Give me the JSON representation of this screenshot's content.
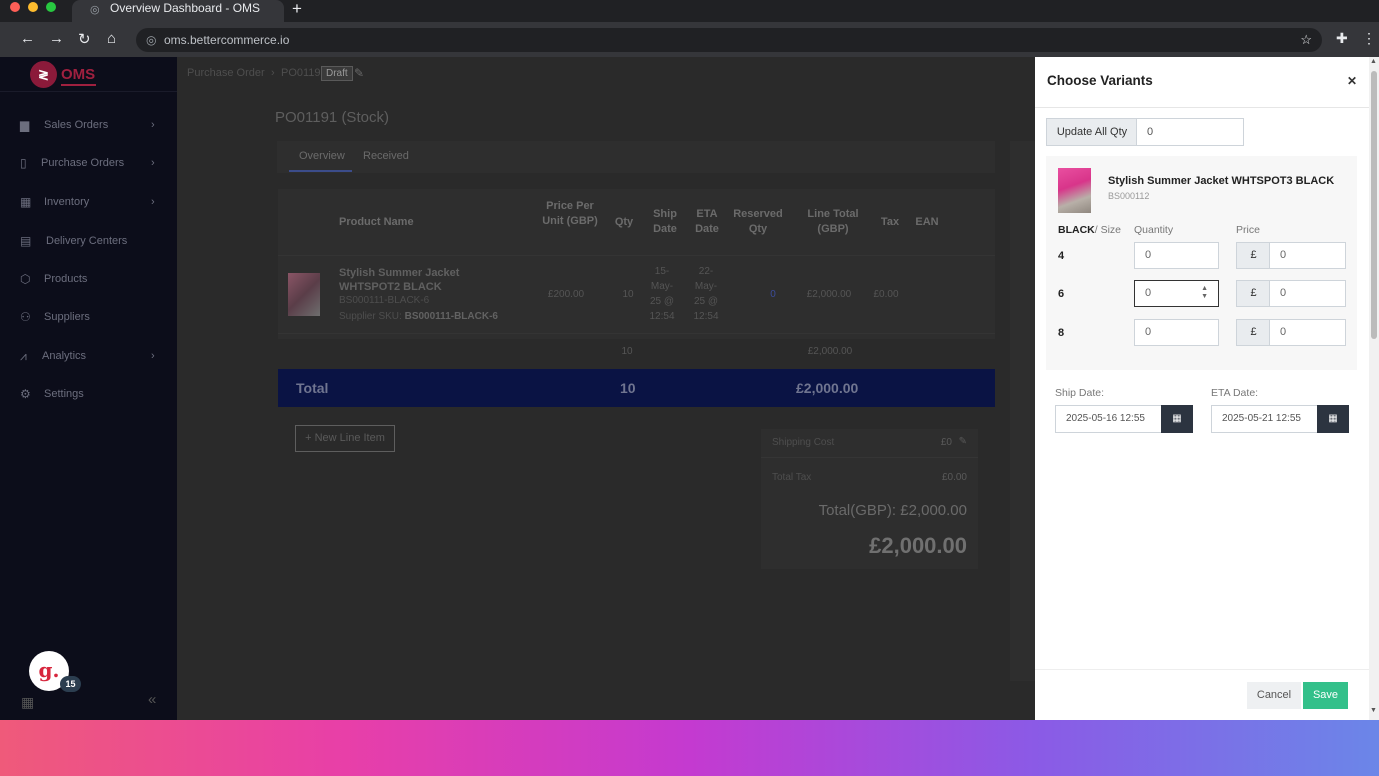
{
  "browser": {
    "tab_title": "Overview Dashboard - OMS",
    "url": "oms.bettercommerce.io"
  },
  "sidebar": {
    "brand": "OMS",
    "items": [
      {
        "label": "Sales Orders",
        "icon": "truck-icon"
      },
      {
        "label": "Purchase Orders",
        "icon": "document-icon"
      },
      {
        "label": "Inventory",
        "icon": "boxes-icon"
      },
      {
        "label": "Delivery Centers",
        "icon": "warehouse-icon"
      },
      {
        "label": "Products",
        "icon": "cube-icon"
      },
      {
        "label": "Suppliers",
        "icon": "users-icon"
      },
      {
        "label": "Analytics",
        "icon": "chart-icon"
      },
      {
        "label": "Settings",
        "icon": "gear-icon"
      }
    ],
    "notification_count": "15",
    "avatar_letter": "g."
  },
  "main": {
    "breadcrumb": [
      "Purchase Order",
      "PO01191"
    ],
    "status": "Draft",
    "title": "PO01191 (Stock)",
    "tabs": [
      "Overview",
      "Received"
    ],
    "table": {
      "headers": [
        "Product Name",
        "Price Per Unit (GBP)",
        "Qty",
        "Ship Date",
        "ETA Date",
        "Reserved Qty",
        "Line Total (GBP)",
        "Tax",
        "EAN"
      ],
      "row": {
        "name": "Stylish Summer Jacket WHTSPOT2 BLACK",
        "sku": "BS000111-BLACK-6",
        "supplier_sku_label": "Supplier SKU:",
        "supplier_sku": "BS000111-BLACK-6",
        "price": "£200.00",
        "qty": "10",
        "ship_date": "15-May-25 @ 12:54",
        "eta_date": "22-May-25 @ 12:54",
        "reserved": "0",
        "line_total": "£2,000.00",
        "tax": "£0.00"
      },
      "subtotal_qty": "10",
      "subtotal_total": "£2,000.00"
    },
    "total": {
      "label": "Total",
      "qty": "10",
      "amount": "£2,000.00"
    },
    "new_line_item": "+ New Line Item",
    "summary": {
      "shipping_label": "Shipping Cost",
      "shipping_value": "£0",
      "tax_label": "Total Tax",
      "tax_value": "£0.00",
      "total_gbp": "Total(GBP): £2,000.00",
      "grand_total": "£2,000.00"
    }
  },
  "modal": {
    "title": "Choose Variants",
    "update_all_label": "Update All Qty",
    "update_all_value": "0",
    "product_name": "Stylish Summer Jacket WHTSPOT3 BLACK",
    "product_sku": "BS000112",
    "color_label": "BLACK",
    "size_label": "/ Size",
    "quantity_header": "Quantity",
    "price_header": "Price",
    "currency": "£",
    "variants": [
      {
        "size": "4",
        "qty": "0",
        "price": "0"
      },
      {
        "size": "6",
        "qty": "0",
        "price": "0"
      },
      {
        "size": "8",
        "qty": "0",
        "price": "0"
      }
    ],
    "ship_date_label": "Ship Date:",
    "ship_date": "2025-05-16 12:55",
    "eta_date_label": "ETA Date:",
    "eta_date": "2025-05-21 12:55",
    "cancel": "Cancel",
    "save": "Save"
  }
}
